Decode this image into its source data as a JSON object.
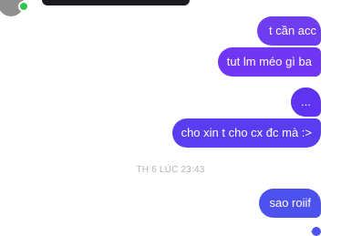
{
  "conversation": {
    "messages": [
      {
        "text": "t cần acc"
      },
      {
        "text": "tut lm méo gì ba"
      },
      {
        "text": "..."
      },
      {
        "text": "cho xin t cho cx đc mà :>"
      },
      {
        "text": "sao roiif"
      }
    ],
    "timestamp": "TH 6 LÚC 23:43"
  },
  "colors": {
    "bubble_purple": "#6f3df0",
    "bubble_blue": "#4d52ef",
    "timestamp_gray": "#b4b4b4",
    "online_green": "#31c653"
  }
}
